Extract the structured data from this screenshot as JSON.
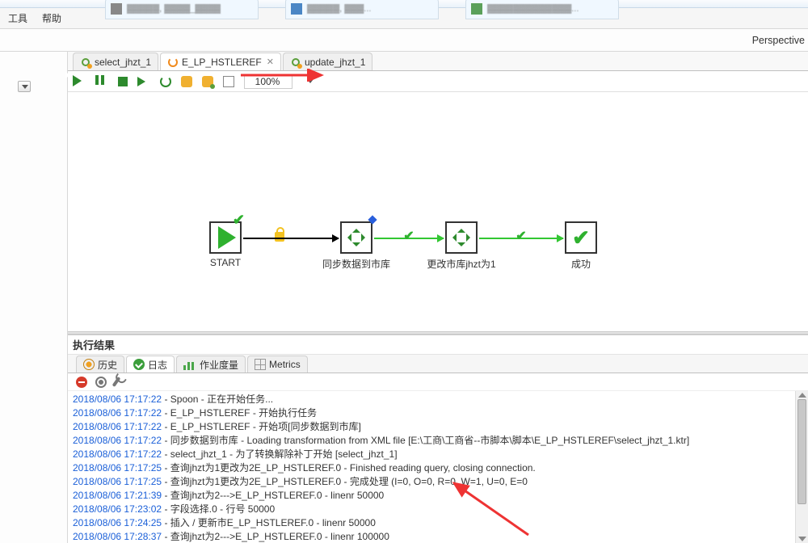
{
  "browser_tabs": [
    {
      "label": "▓▓▓▓▓, ▓▓▓▓_▓▓▓▓"
    },
    {
      "label": "▓▓▓▓▓, ▓▓▓..."
    },
    {
      "label": "▓▓▓▓▓▓▓▓▓▓▓▓▓..."
    }
  ],
  "menu": {
    "tools": "工具",
    "help": "帮助"
  },
  "perspective": "Perspective",
  "tabs": [
    {
      "label": "select_jhzt_1",
      "icon": "transform"
    },
    {
      "label": "E_LP_HSTLEREF",
      "icon": "job",
      "active": true,
      "closable": true
    },
    {
      "label": "update_jhzt_1",
      "icon": "transform"
    }
  ],
  "toolbar": {
    "zoom": "100%"
  },
  "nodes": {
    "start": "START",
    "sync": "同步数据到市库",
    "update": "更改市库jhzt为1",
    "ok": "成功"
  },
  "results": {
    "title": "执行结果",
    "tabs": {
      "history": "历史",
      "log": "日志",
      "jobmetrics": "作业度量",
      "metrics": "Metrics"
    },
    "lines": [
      {
        "ts": "2018/08/06 17:17:22",
        "msg": "Spoon - 正在开始任务..."
      },
      {
        "ts": "2018/08/06 17:17:22",
        "msg": "E_LP_HSTLEREF - 开始执行任务"
      },
      {
        "ts": "2018/08/06 17:17:22",
        "msg": "E_LP_HSTLEREF - 开始项[同步数据到市库]"
      },
      {
        "ts": "2018/08/06 17:17:22",
        "msg": "同步数据到市库 - Loading transformation from XML file [E:\\工商\\工商省--市脚本\\脚本\\E_LP_HSTLEREF\\select_jhzt_1.ktr]"
      },
      {
        "ts": "2018/08/06 17:17:22",
        "msg": "select_jhzt_1 - 为了转换解除补丁开始  [select_jhzt_1]"
      },
      {
        "ts": "2018/08/06 17:17:25",
        "msg": "查询jhzt为1更改为2E_LP_HSTLEREF.0 - Finished reading query, closing connection."
      },
      {
        "ts": "2018/08/06 17:17:25",
        "msg": "查询jhzt为1更改为2E_LP_HSTLEREF.0 - 完成处理 (I=0, O=0, R=0, W=1, U=0, E=0"
      },
      {
        "ts": "2018/08/06 17:21:39",
        "msg": "查询jhzt为2--->E_LP_HSTLEREF.0 - linenr 50000"
      },
      {
        "ts": "2018/08/06 17:23:02",
        "msg": "字段选择.0 - 行号 50000"
      },
      {
        "ts": "2018/08/06 17:24:25",
        "msg": "插入 / 更新市E_LP_HSTLEREF.0 - linenr 50000"
      },
      {
        "ts": "2018/08/06 17:28:37",
        "msg": "查询jhzt为2--->E_LP_HSTLEREF.0 - linenr 100000"
      }
    ]
  }
}
